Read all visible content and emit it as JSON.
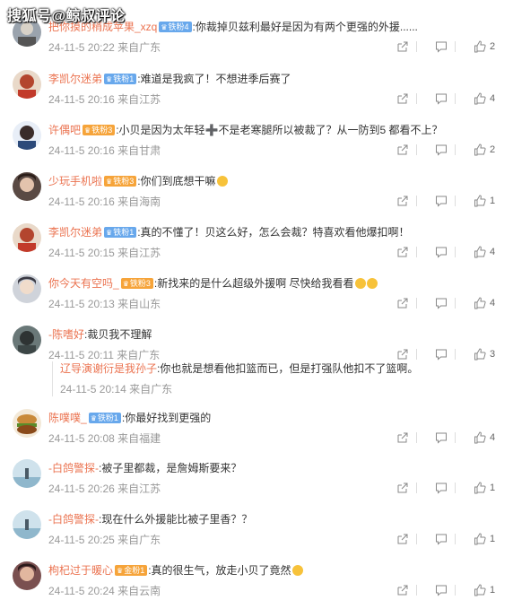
{
  "watermark": "搜狐号@鲸叔评论",
  "comments": [
    {
      "name": "把你摸的稍成苹果_xzq",
      "badge": "铁粉4",
      "badge_color": "blue",
      "text": ":你裁掉贝兹利最好是因为有两个更强的外援......",
      "time": "24-11-5 20:22 来自广东",
      "likes": "2",
      "avatar_color": "#9aa3ad"
    },
    {
      "name": "李凯尔迷弟",
      "badge": "铁粉1",
      "badge_color": "blue",
      "text": ":难道是我疯了！不想进季后赛了",
      "time": "24-11-5 20:16 来自江苏",
      "likes": "4",
      "avatar_color": "#b3452e"
    },
    {
      "name": "许偶吧",
      "badge": "铁粉3",
      "badge_color": "orange",
      "text": ":小贝是因为太年轻➕不是老寒腿所以被裁了？从一防到5 都看不上？",
      "time": "24-11-5 20:16 来自甘肃",
      "likes": "2",
      "avatar_color": "#2c4a7a"
    },
    {
      "name": "少玩手机啦",
      "badge": "铁粉3",
      "badge_color": "orange",
      "text": ":你们到底想干嘛",
      "time": "24-11-5 20:16 来自海南",
      "likes": "1",
      "avatar_color": "#7a5c4c"
    },
    {
      "name": "李凯尔迷弟",
      "badge": "铁粉1",
      "badge_color": "blue",
      "text": ":真的不懂了！贝这么好，怎么会裁？特喜欢看他爆扣啊！",
      "time": "24-11-5 20:15 来自江苏",
      "likes": "4",
      "avatar_color": "#b3452e"
    },
    {
      "name": "你今天有空吗_",
      "badge": "铁粉3",
      "badge_color": "orange",
      "text": ":新找来的是什么超级外援啊  尽快给我看看",
      "time": "24-11-5 20:13 来自山东",
      "likes": "4",
      "avatar_color": "#6b6f78"
    },
    {
      "name": "-陈嗜好",
      "badge": "",
      "badge_color": "",
      "text": ":裁贝我不理解",
      "time": "24-11-5 20:11 来自广东",
      "likes": "3",
      "avatar_color": "#4f5a5a",
      "reply": {
        "name": "辽导演谢衍是我孙子",
        "text": ":你也就是想看他扣篮而已，但是打强队他扣不了篮啊。",
        "time": "24-11-5 20:14 来自广东"
      }
    },
    {
      "name": "陈噗噗_",
      "badge": "铁粉1",
      "badge_color": "blue",
      "text": ":你最好找到更强的",
      "time": "24-11-5 20:08 来自福建",
      "likes": "4",
      "avatar_color": "#c98a3a"
    },
    {
      "name": "-白鸽警探-",
      "badge": "",
      "badge_color": "",
      "text": ":被子里都裁，是詹姆斯要来？",
      "time": "24-11-5 20:26 来自江苏",
      "likes": "1",
      "avatar_color": "#8fb7cc"
    },
    {
      "name": "-白鸽警探-",
      "badge": "",
      "badge_color": "",
      "text": ":现在什么外援能比被子里香？？",
      "time": "24-11-5 20:25 来自广东",
      "likes": "1",
      "avatar_color": "#8fb7cc"
    },
    {
      "name": "枸杞过于暖心",
      "badge": "金粉1",
      "badge_color": "orange",
      "text": ":真的很生气，放走小贝了竟然",
      "time": "24-11-5 20:24 来自云南",
      "likes": "1",
      "avatar_color": "#7a5050"
    }
  ]
}
